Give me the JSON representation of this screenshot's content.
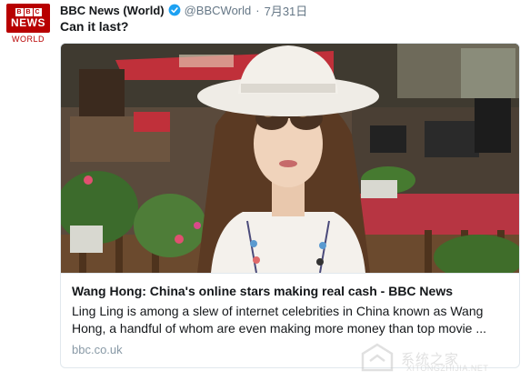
{
  "account": {
    "avatar_logo": "BBC",
    "avatar_line1": "NEWS",
    "avatar_line2": "WORLD",
    "display_name": "BBC News (World)",
    "handle": "@BBCWorld",
    "separator": "·",
    "date": "7月31日",
    "verified_icon": "verified-badge-icon",
    "verified_color": "#1da1f2"
  },
  "tweet": {
    "text": "Can it last?"
  },
  "card": {
    "image_icon": "photo-woman-in-sunhat",
    "title": "Wang Hong: China's online stars making real cash - BBC News",
    "description": "Ling Ling is among a slew of internet celebrities in China known as Wang Hong, a handful of whom are even making more money than top movie ...",
    "domain": "bbc.co.uk"
  },
  "watermark": {
    "text": "系统之家",
    "site": "XITONGZHIJIA.NET"
  },
  "colors": {
    "bbc_red": "#b80000",
    "text_primary": "#14171a",
    "text_secondary": "#657786",
    "border": "#e1e8ed"
  }
}
